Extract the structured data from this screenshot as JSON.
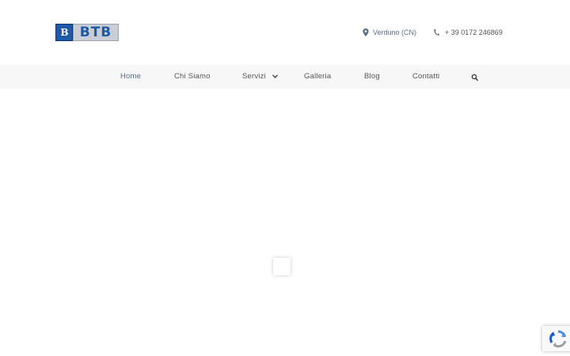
{
  "logo": {
    "mark": "B",
    "text": "BTB"
  },
  "contact": {
    "location": "Verduno (CN)",
    "phone": "+ 39 0172 246869",
    "location_icon": "map-marker-icon",
    "phone_icon": "phone-icon"
  },
  "nav": {
    "items": [
      {
        "label": "Home",
        "active": true
      },
      {
        "label": "Chi Siamo"
      },
      {
        "label": "Servizi",
        "has_dropdown": true
      },
      {
        "label": "Galleria"
      },
      {
        "label": "Blog"
      },
      {
        "label": "Contatti"
      }
    ],
    "search_icon": "search-icon"
  },
  "colors": {
    "accent": "#4a6a96",
    "logo_blue": "#1e5aa8",
    "nav_background": "#f7f7f7",
    "text": "#555555"
  }
}
